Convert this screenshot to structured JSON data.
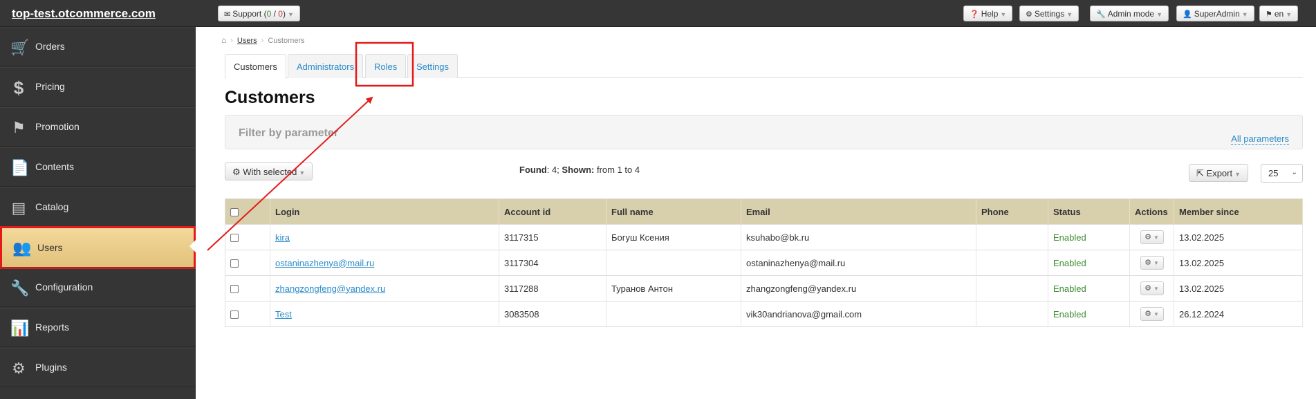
{
  "topbar": {
    "site_title": "top-test.otcommerce.com",
    "support_label": "Support (",
    "support_count_a": "0",
    "support_slash": " / ",
    "support_count_b": "0",
    "support_close": ")",
    "help_label": "Help",
    "settings_label": "Settings",
    "admin_mode_label": "Admin mode",
    "user_label": "SuperAdmin",
    "lang_label": "en"
  },
  "sidebar": {
    "items": [
      {
        "label": "Orders",
        "icon": "cart-icon"
      },
      {
        "label": "Pricing",
        "icon": "dollar-icon"
      },
      {
        "label": "Promotion",
        "icon": "flag-icon"
      },
      {
        "label": "Contents",
        "icon": "file-icon"
      },
      {
        "label": "Catalog",
        "icon": "catalog-icon"
      },
      {
        "label": "Users",
        "icon": "users-icon",
        "active": true
      },
      {
        "label": "Configuration",
        "icon": "wrench-icon"
      },
      {
        "label": "Reports",
        "icon": "chart-icon"
      },
      {
        "label": "Plugins",
        "icon": "gear-icon"
      }
    ]
  },
  "breadcrumb": {
    "users": "Users",
    "current": "Customers"
  },
  "tabs": [
    {
      "label": "Customers",
      "active": true
    },
    {
      "label": "Administrators"
    },
    {
      "label": "Roles"
    },
    {
      "label": "Settings"
    }
  ],
  "page_title": "Customers",
  "filter": {
    "title": "Filter by parameter",
    "all_params": "All parameters"
  },
  "toolbar": {
    "with_selected": "With selected",
    "found_label": "Found",
    "found_value": ": 4; ",
    "shown_label": "Shown:",
    "shown_value": " from 1 to 4",
    "export": "Export",
    "page_size": "25"
  },
  "table": {
    "columns": [
      "Login",
      "Account id",
      "Full name",
      "Email",
      "Phone",
      "Status",
      "Actions",
      "Member since"
    ],
    "rows": [
      {
        "login": "kira",
        "account_id": "3117315",
        "full_name": "Богуш Ксения",
        "email": "ksuhabo@bk.ru",
        "phone": "",
        "status": "Enabled",
        "member_since": "13.02.2025"
      },
      {
        "login": "ostaninazhenya@mail.ru",
        "account_id": "3117304",
        "full_name": "",
        "email": "ostaninazhenya@mail.ru",
        "phone": "",
        "status": "Enabled",
        "member_since": "13.02.2025"
      },
      {
        "login": "zhangzongfeng@yandex.ru",
        "account_id": "3117288",
        "full_name": "Туранов Антон",
        "email": "zhangzongfeng@yandex.ru",
        "phone": "",
        "status": "Enabled",
        "member_since": "13.02.2025"
      },
      {
        "login": "Test",
        "account_id": "3083508",
        "full_name": "",
        "email": "vik30andrianova@gmail.com",
        "phone": "",
        "status": "Enabled",
        "member_since": "26.12.2024"
      }
    ]
  },
  "colors": {
    "accent": "#2a8bc9",
    "annotation": "#e41a1a",
    "table_header": "#d8d0ad",
    "status_enabled": "#3c8d2f",
    "sidebar_bg": "#353535",
    "sidebar_active": "#f3d99b"
  }
}
